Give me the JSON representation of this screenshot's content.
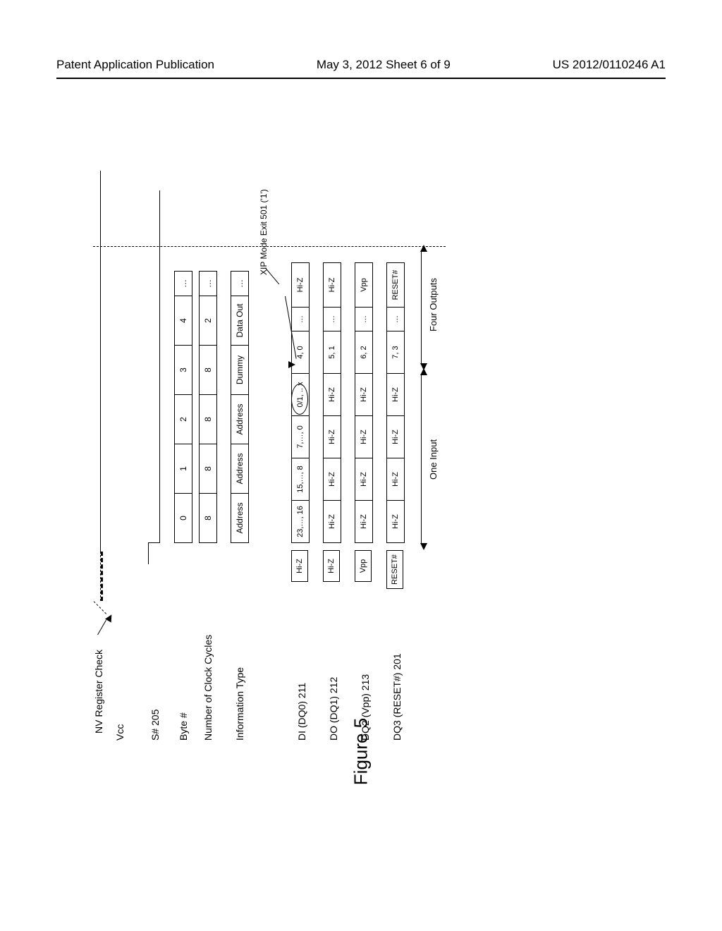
{
  "header": {
    "left": "Patent Application Publication",
    "center": "May 3, 2012   Sheet 6 of 9",
    "right": "US 2012/0110246 A1"
  },
  "figureLabel": "Figure 5",
  "diagram": {
    "nvRegisterCheck": "NV Register Check",
    "vccLabel": "Vcc",
    "sNumLabel": "S#  205",
    "byteNumLabel": "Byte #",
    "byteNumCells": [
      "0",
      "1",
      "2",
      "3",
      "4",
      "…"
    ],
    "clkLabel": "Number of Clock Cycles",
    "clkCells": [
      "8",
      "8",
      "8",
      "8",
      "2",
      "…"
    ],
    "infoLabel": "Information Type",
    "infoCells": [
      "Address",
      "Address",
      "Address",
      "Dummy",
      "Data Out",
      "…"
    ],
    "xipExit": "XIP Mode Exit  501  ('1')",
    "di": {
      "label": "DI (DQ0)  211",
      "lead": "Hi-Z",
      "cells": [
        "23,…, 16",
        "15,…, 8",
        "7,…, 0",
        "0/1, .. x",
        "4, 0",
        "…",
        "Hi-Z"
      ]
    },
    "do": {
      "label": "DO (DQ1)  212",
      "lead": "Hi-Z",
      "cells": [
        "Hi-Z",
        "Hi-Z",
        "Hi-Z",
        "Hi-Z",
        "5, 1",
        "…",
        "Hi-Z"
      ]
    },
    "dq2": {
      "label": "DQ2 (Vpp)  213",
      "lead": "Vpp",
      "cells": [
        "Hi-Z",
        "Hi-Z",
        "Hi-Z",
        "Hi-Z",
        "6, 2",
        "…",
        "Vpp"
      ]
    },
    "dq3": {
      "label": "DQ3 (RESET#)  201",
      "lead": "RESET#",
      "cells": [
        "Hi-Z",
        "Hi-Z",
        "Hi-Z",
        "Hi-Z",
        "7, 3",
        "…",
        "RESET#"
      ]
    },
    "oneInput": "One Input",
    "fourOutputs": "Four Outputs"
  }
}
